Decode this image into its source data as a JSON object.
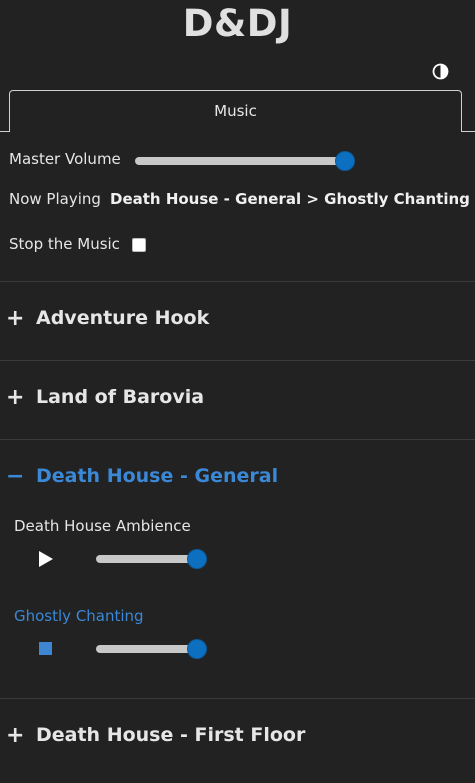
{
  "app": {
    "title": "D&DJ"
  },
  "theme_toggle": {
    "icon": "contrast-icon"
  },
  "tabs": [
    {
      "label": "Music",
      "active": true
    }
  ],
  "master": {
    "volume_label": "Master Volume",
    "volume_level": 1.0,
    "now_playing_label": "Now Playing",
    "now_playing_value": "Death House - General > Ghostly Chanting",
    "stop_label": "Stop the Music",
    "stop_checked": false
  },
  "sections": [
    {
      "title": "Adventure Hook",
      "expanded": false,
      "sign": "+"
    },
    {
      "title": "Land of Barovia",
      "expanded": false,
      "sign": "+"
    },
    {
      "title": "Death House - General",
      "expanded": true,
      "sign": "−",
      "tracks": [
        {
          "name": "Death House Ambience",
          "playing": false,
          "control_icon": "play-icon",
          "volume_level": 1.0
        },
        {
          "name": "Ghostly Chanting",
          "playing": true,
          "control_icon": "stop-icon",
          "volume_level": 1.0
        }
      ]
    },
    {
      "title": "Death House - First Floor",
      "expanded": false,
      "sign": "+"
    }
  ],
  "colors": {
    "background": "#222222",
    "accent": "#3a88d6",
    "slider_thumb": "#0d6fbf",
    "text": "#e6e6e6"
  }
}
